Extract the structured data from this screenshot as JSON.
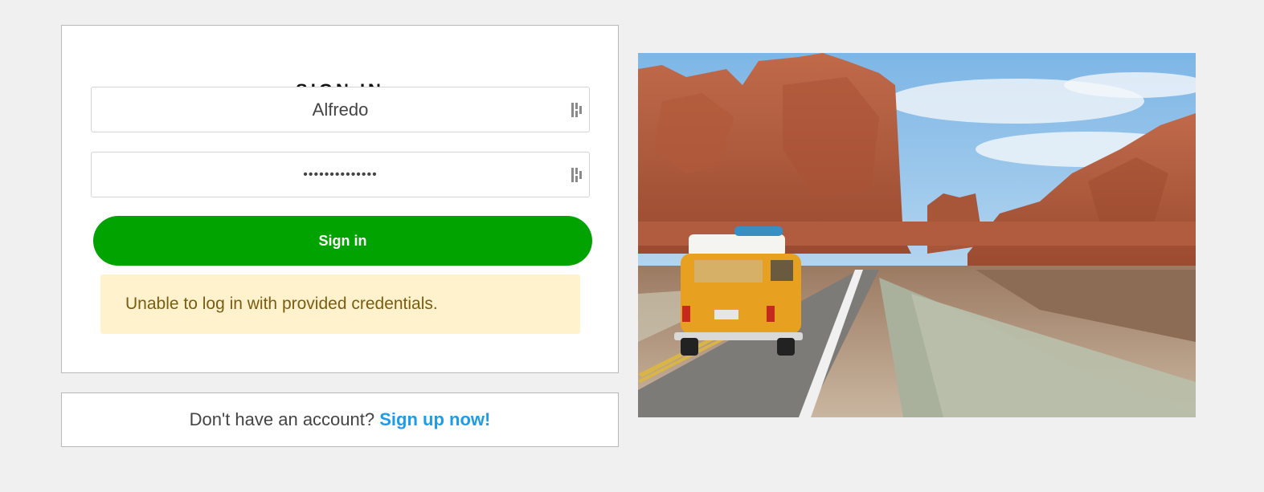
{
  "signin": {
    "title": "SIGN IN",
    "username_value": "Alfredo",
    "password_masked": "••••••••••••••",
    "submit_label": "Sign in",
    "error_message": "Unable to log in with provided credentials."
  },
  "signup": {
    "prompt": "Don't have an account?",
    "link_label": "Sign up now!"
  },
  "colors": {
    "button_green": "#00a300",
    "alert_bg": "#fff2cc",
    "alert_text": "#7a5c12",
    "link_blue": "#1e9be9"
  },
  "icons": {
    "password_manager": "password-manager-key-icon"
  }
}
